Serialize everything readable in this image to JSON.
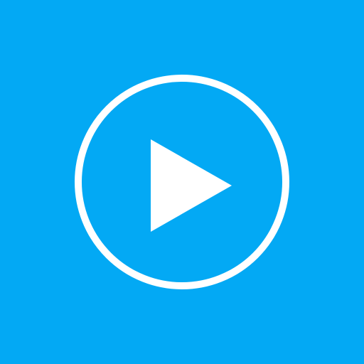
{
  "icon": {
    "name": "play-icon",
    "background_color": "#03a9f4",
    "foreground_color": "#ffffff"
  }
}
